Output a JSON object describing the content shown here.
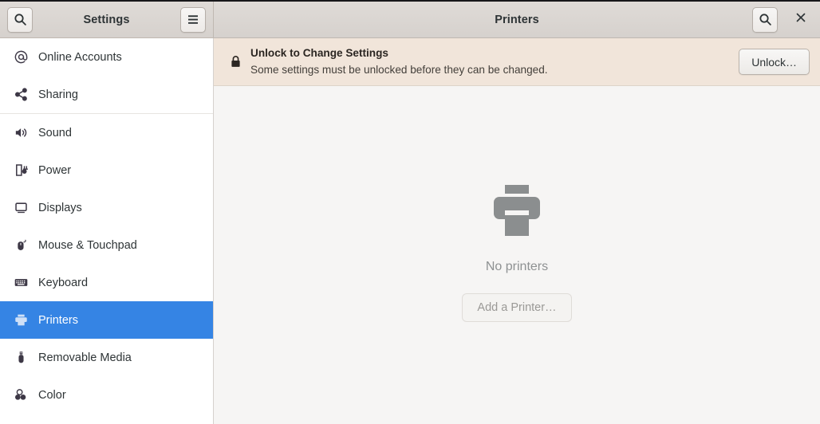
{
  "window": {
    "app_title": "Settings",
    "page_title": "Printers"
  },
  "headerbar": {
    "search_icon": "search-icon",
    "menu_icon": "hamburger-menu-icon",
    "content_search_icon": "search-icon",
    "close_icon": "close-icon"
  },
  "sidebar": {
    "items": [
      {
        "label": "Online Accounts",
        "icon": "at-sign-icon",
        "selected": false,
        "separator_after": false
      },
      {
        "label": "Sharing",
        "icon": "share-nodes-icon",
        "selected": false,
        "separator_after": true
      },
      {
        "label": "Sound",
        "icon": "speaker-icon",
        "selected": false,
        "separator_after": false
      },
      {
        "label": "Power",
        "icon": "battery-plug-icon",
        "selected": false,
        "separator_after": false
      },
      {
        "label": "Displays",
        "icon": "monitor-icon",
        "selected": false,
        "separator_after": false
      },
      {
        "label": "Mouse & Touchpad",
        "icon": "mouse-icon",
        "selected": false,
        "separator_after": false
      },
      {
        "label": "Keyboard",
        "icon": "keyboard-icon",
        "selected": false,
        "separator_after": false
      },
      {
        "label": "Printers",
        "icon": "printer-icon",
        "selected": true,
        "separator_after": false
      },
      {
        "label": "Removable Media",
        "icon": "usb-drive-icon",
        "selected": false,
        "separator_after": false
      },
      {
        "label": "Color",
        "icon": "color-circles-icon",
        "selected": false,
        "separator_after": false
      }
    ],
    "selected_color": "#3584e4"
  },
  "banner": {
    "icon": "lock-icon",
    "title": "Unlock to Change Settings",
    "subtitle": "Some settings must be unlocked before they can be changed.",
    "button_label": "Unlock…",
    "background_color": "#f1e5da"
  },
  "empty_state": {
    "icon": "printer-icon",
    "title": "No printers",
    "button_label": "Add a Printer…",
    "button_disabled": true,
    "icon_color": "#8b8e8f"
  }
}
